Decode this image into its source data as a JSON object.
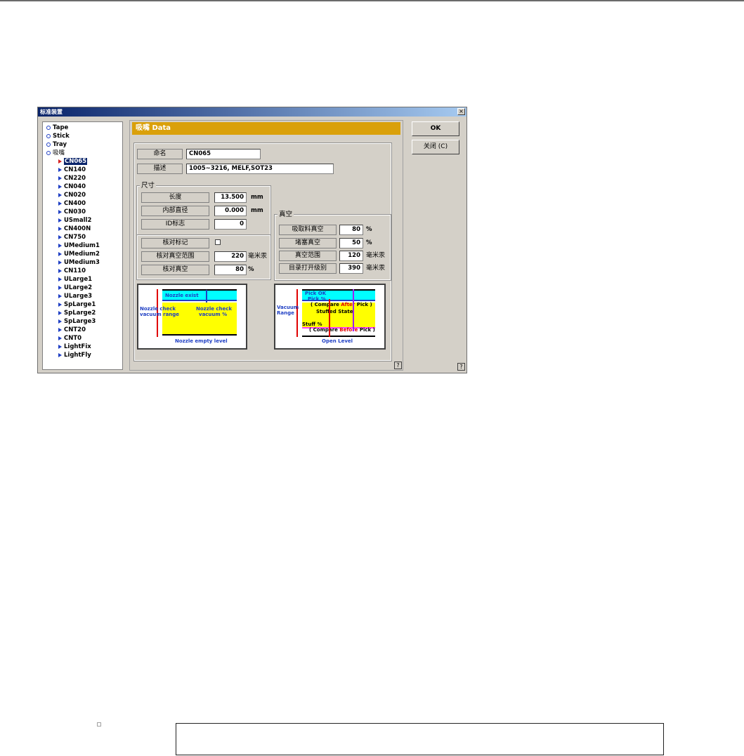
{
  "window": {
    "title": "标准装置",
    "close_label": "×"
  },
  "tree": {
    "categories": [
      "Tape",
      "Stick",
      "Tray",
      "吸嘴"
    ],
    "nozzles": [
      "CN065",
      "CN140",
      "CN220",
      "CN040",
      "CN020",
      "CN400",
      "CN030",
      "USmall2",
      "CN400N",
      "CN750",
      "UMedium1",
      "UMedium2",
      "UMedium3",
      "CN110",
      "ULarge1",
      "ULarge2",
      "ULarge3",
      "SpLarge1",
      "SpLarge2",
      "SpLarge3",
      "CNT20",
      "CNT0",
      "LightFix",
      "LightFly"
    ],
    "selected": "CN065"
  },
  "header": {
    "title": "吸嘴 Data"
  },
  "form": {
    "name_label": "命名",
    "name_value": "CN065",
    "desc_label": "描述",
    "desc_value": "1005~3216, MELF,SOT23"
  },
  "size": {
    "group_title": "尺寸",
    "length_label": "长度",
    "length_value": "13.500",
    "length_unit": "mm",
    "inner_label": "内部直径",
    "inner_value": "0.000",
    "inner_unit": "mm",
    "id_label": "ID标志",
    "id_value": "0"
  },
  "check": {
    "mark_label": "核对标记",
    "mark_checked": false,
    "range_label": "核对真空范围",
    "range_value": "220",
    "range_unit": "毫米汞",
    "vac_label": "核对真空",
    "vac_value": "80",
    "vac_unit": "%"
  },
  "vacuum": {
    "group_title": "真空",
    "pick_label": "吸取料真空",
    "pick_value": "80",
    "pick_unit": "%",
    "stuff_label": "堵塞真空",
    "stuff_value": "50",
    "stuff_unit": "%",
    "range_label": "真空范围",
    "range_value": "120",
    "range_unit": "毫米汞",
    "open_label": "目录打开级别",
    "open_value": "390",
    "open_unit": "毫米汞"
  },
  "buttons": {
    "ok": "OK",
    "close": "关闭 (C)",
    "help": "?"
  },
  "diagram1": {
    "nozzle_exist": "Nozzle exist",
    "check_range_1": "Nozzle check",
    "check_range_2": "vacuum range",
    "check_pct_1": "Nozzle check",
    "check_pct_2": "vacuum %",
    "empty_level": "Nozzle empty level"
  },
  "diagram2": {
    "pick_ok": "Pick OK",
    "pick_pct": "Pick %",
    "compare_after_pre": "( Compare ",
    "compare_after_word": "After",
    "compare_after_post": " Pick )",
    "stuffed": "Stuffed State",
    "stuff_pct": "Stuff %",
    "compare_before_pre": "( Compare ",
    "compare_before_word": "Before",
    "compare_before_post": " Pick )",
    "vac_range_1": "Vacuum",
    "vac_range_2": "Range",
    "open_level": "Open Level"
  },
  "colors": {
    "header": "#daa00a",
    "cyan": "#00ffff",
    "yellow": "#ffff00",
    "blue": "#1f3fc4",
    "red": "#e00000",
    "magenta": "#ff40ff"
  }
}
